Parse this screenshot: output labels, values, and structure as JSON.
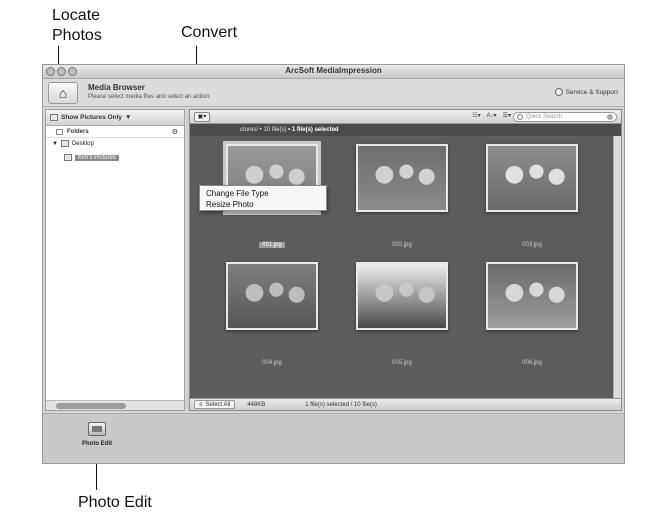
{
  "callouts": {
    "locate_photos": "Locate\nPhotos",
    "convert": "Convert",
    "photo_edit": "Photo Edit"
  },
  "window": {
    "title": "ArcSoft MediaImpression"
  },
  "header": {
    "title": "Media Browser",
    "subtitle": "Please select media files and select an action.",
    "service": "Service & Support"
  },
  "left_panel": {
    "filter_label": "Show Pictures Only",
    "folders_header": "Folders",
    "tree": [
      {
        "label": "Desktop"
      },
      {
        "label": "Kim's Pictures"
      }
    ]
  },
  "right_panel": {
    "search_placeholder": "Quick Search",
    "path_text": "ctures/ • 10 file(s)",
    "path_selected": "• 1 file(s) selected",
    "view_icons": [
      "☷▾",
      "A↓▾",
      "☰▾"
    ]
  },
  "dropdown": {
    "items": [
      "Change File Type",
      "Resize Photo"
    ]
  },
  "thumbnails": [
    {
      "label": "001.jpg",
      "selected": true,
      "palette": [
        "#7a7a7a",
        "#cfcfcf",
        "#9a9a9a"
      ]
    },
    {
      "label": "002.jpg",
      "selected": false,
      "palette": [
        "#8a8a8a",
        "#d2d2d2",
        "#6e6e6e"
      ]
    },
    {
      "label": "003.jpg",
      "selected": false,
      "palette": [
        "#6a6a6a",
        "#e0e0e0",
        "#8c8c8c"
      ]
    },
    {
      "label": "004.jpg",
      "selected": false,
      "palette": [
        "#555555",
        "#bdbdbd",
        "#7f7f7f"
      ]
    },
    {
      "label": "005.jpg",
      "selected": false,
      "palette": [
        "#4a4a4a",
        "#c7c7c7",
        "#eeeeee"
      ]
    },
    {
      "label": "006.jpg",
      "selected": false,
      "palette": [
        "#9e9e9e",
        "#d8d8d8",
        "#6a6a6a"
      ]
    }
  ],
  "status_bar": {
    "select_all": "Select All",
    "size": "448KB",
    "selection": "1 file(s) selected / 10 file(s)"
  },
  "dock": {
    "photo_edit_label": "Photo Edit"
  }
}
